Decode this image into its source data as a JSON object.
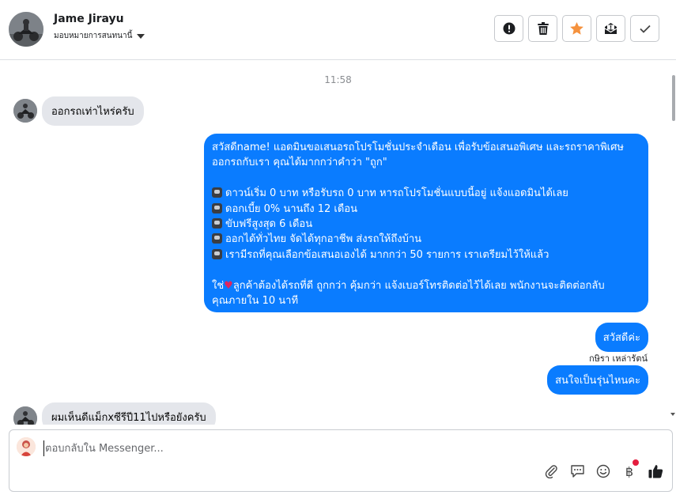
{
  "header": {
    "contact_name": "Jame Jirayu",
    "assign_label": "มอบหมายการสนทนานี้",
    "actions": [
      {
        "name": "report-button",
        "icon": "exclamation-circle-icon"
      },
      {
        "name": "delete-button",
        "icon": "trash-icon"
      },
      {
        "name": "star-button",
        "icon": "star-icon"
      },
      {
        "name": "mark-spam-button",
        "icon": "spam-inbox-icon"
      },
      {
        "name": "mark-done-button",
        "icon": "checkmark-icon"
      }
    ],
    "star_color": "#f5923e"
  },
  "conversation": {
    "timestamp": "11:58",
    "msg_in_1": "ออกรถเท่าไหร่ครับ",
    "big_message": {
      "line1": "สวัสดีname! แอดมินขอเสนอรถโปรโมชั่นประจำเดือน เพื่อรับข้อเสนอพิเศษ และรถราคาพิเศษ",
      "line2": "ออกรถกับเรา คุณได้มากกว่าคำว่า \"ถูก\"",
      "bullet1": "ดาวน์เริ่ม 0 บาท หรือรับรถ 0 บาท หารถโปรโมชั่นแบบนี้อยู่ แจ้งแอดมินได้เลย",
      "bullet2": "ดอกเบี้ย 0% นานถึง 12 เดือน",
      "bullet3": "ขับฟรีสูงสุด 6 เดือน",
      "bullet4": "ออกได้ทั่วไทย จัดได้ทุกอาชีพ ส่งรถให้ถึงบ้าน",
      "bullet5": "เรามีรถที่คุณเลือกข้อเสนอเองได้ มากกว่า 50 รายการ เราเตรียมไว้ให้แล้ว",
      "closing_prefix": "ใช่",
      "closing_rest": "ลูกค้าต้องได้รถที่ดี ถูกกว่า คุ้มกว่า แจ้งเบอร์โทรติดต่อไว้ได้เลย พนักงานจะติดต่อกลับ",
      "closing_line2": "คุณภายใน 10 นาที"
    },
    "msg_out_2": "สวัสดีค่ะ",
    "sender_label": "กษิรา เหล่ารัตน์",
    "msg_out_3": "สนใจเป็นรุ่นไหนคะ",
    "msg_in_2": "ผมเห็นดีแม็กxซีรีปี11ไปหรือยังครับ"
  },
  "composer": {
    "placeholder": "ตอบกลับใน Messenger...",
    "tools": [
      "paperclip-icon",
      "chat-bubble-icon",
      "smiley-icon",
      "baht-icon",
      "thumbs-up-icon"
    ],
    "baht_symbol": "฿"
  },
  "colors": {
    "outgoing_bubble": "#0a7cff",
    "incoming_bubble": "#e4e6eb",
    "notification_dot": "#e41e3f"
  }
}
